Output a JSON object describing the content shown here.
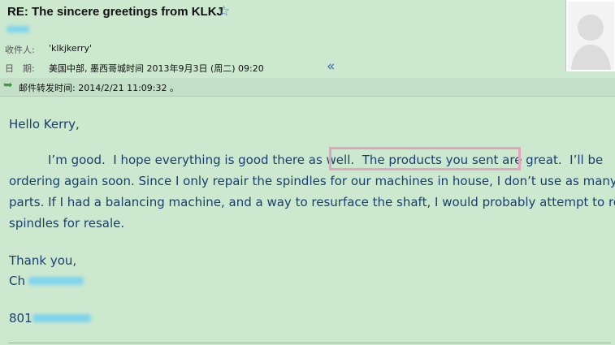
{
  "header": {
    "subject": "RE: The sincere greetings from KLKJ",
    "star_icon": "star-outline-icon",
    "to_label": "收件人:",
    "to_value": "'klkjkerry'",
    "date_label": "日　期:",
    "date_value": "美国中部, 墨西哥城时间 2013年9月3日 (周二) 09:20",
    "collapse_icon": "double-chevron-left-icon",
    "avatar_icon": "default-avatar-icon"
  },
  "forward": {
    "icon": "forward-arrow-icon",
    "text": "邮件转发时间: 2014/2/21 11:09:32 。"
  },
  "body": {
    "greeting": "Hello Kerry,",
    "p1_line1_a": "I’m good.  I hope everything is good there as well.  ",
    "p1_line1_highlight": "The products you sent are great.",
    "p1_line1_b": "  I’ll be",
    "p1_line2": "ordering again soon.  Since I only repair the spindles for our machines in house, I don’t use as many",
    "p1_line3": "parts.  If I had a balancing machine, and a way to resurface the shaft, I would probably attempt to repair",
    "p1_line4": "spindles for resale.",
    "closing": "Thank you,",
    "signature_visible": "Ch",
    "phone_visible": "801"
  }
}
